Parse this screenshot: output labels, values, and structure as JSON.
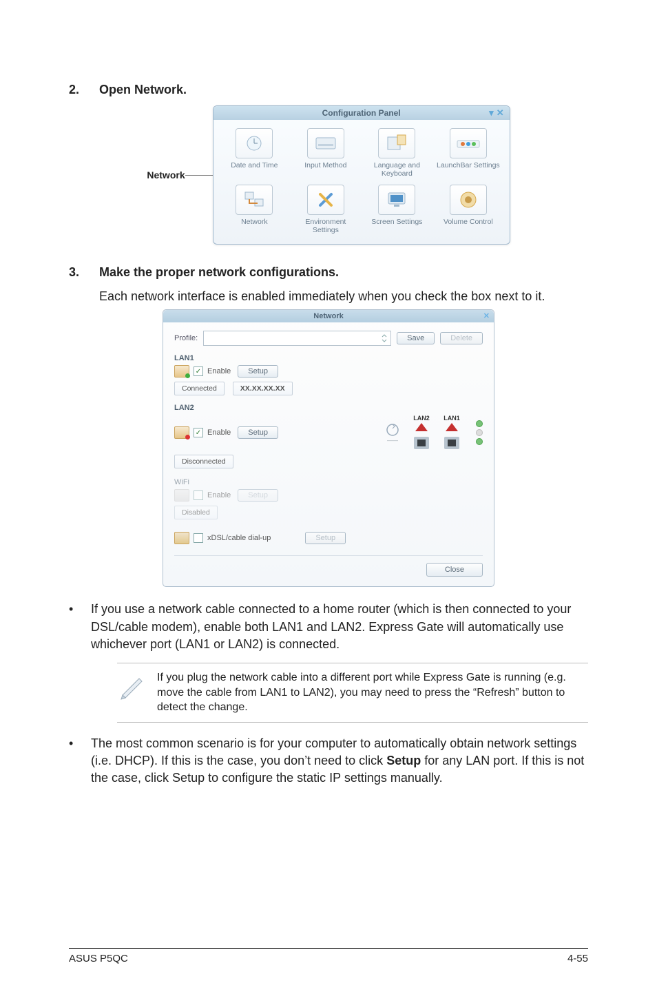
{
  "step2": {
    "num": "2.",
    "title": "Open Network."
  },
  "network_callout": "Network",
  "config_panel": {
    "title": "Configuration Panel",
    "items": [
      {
        "label": "Date and Time"
      },
      {
        "label": "Input Method"
      },
      {
        "label": "Language and Keyboard"
      },
      {
        "label": "LaunchBar Settings"
      },
      {
        "label": "Network"
      },
      {
        "label": "Environment Settings"
      },
      {
        "label": "Screen Settings"
      },
      {
        "label": "Volume Control"
      }
    ]
  },
  "step3": {
    "num": "3.",
    "title": "Make the proper network configurations.",
    "body": "Each network interface is enabled immediately when you check the box next to it."
  },
  "net_dialog": {
    "title": "Network",
    "profile_label": "Profile:",
    "save": "Save",
    "delete": "Delete",
    "lan1": {
      "title": "LAN1",
      "enable": "Enable",
      "setup": "Setup",
      "status": "Connected",
      "ip": "XX.XX.XX.XX"
    },
    "lan2": {
      "title": "LAN2",
      "enable": "Enable",
      "setup": "Setup",
      "status": "Disconnected",
      "port2": "LAN2",
      "port1": "LAN1"
    },
    "wifi": {
      "title": "WiFi",
      "enable": "Enable",
      "setup": "Setup",
      "status": "Disabled"
    },
    "dial": {
      "label": "xDSL/cable dial-up",
      "setup": "Setup"
    },
    "close": "Close"
  },
  "bullet1": "If you use a network cable connected to a home router (which is then connected to your DSL/cable modem), enable both LAN1 and LAN2. Express Gate  will automatically use whichever port (LAN1 or LAN2) is connected.",
  "note": "If you plug the network cable into a different port while Express Gate  is running (e.g. move the cable from LAN1 to LAN2), you may need to press the “Refresh” button to detect the change.",
  "bullet2_pre": "The most common scenario is for your computer to automatically obtain network settings (i.e. DHCP). If this is the case, you don’t need to click ",
  "bullet2_strong": "Setup",
  "bullet2_post": " for any LAN port. If this is not the case, click Setup to configure the static IP settings manually.",
  "footer": {
    "left": "ASUS P5QC",
    "right": "4-55"
  }
}
